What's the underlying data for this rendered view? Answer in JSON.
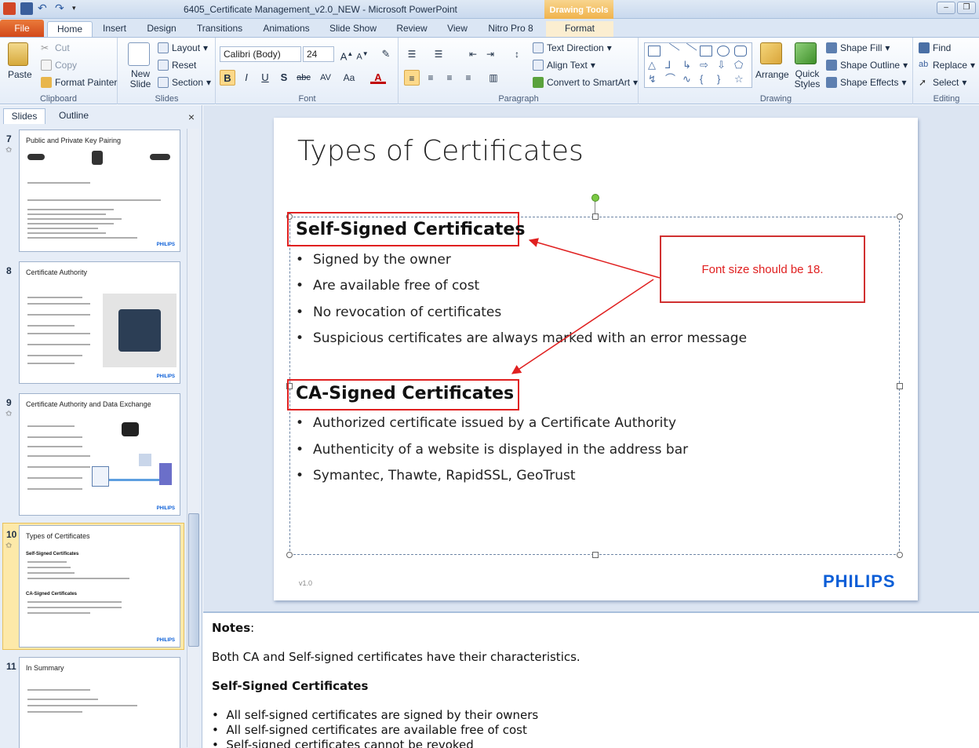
{
  "app": {
    "window_title": "6405_Certificate Management_v2.0_NEW  -  Microsoft PowerPoint",
    "context_tab_group": "Drawing Tools"
  },
  "tabs": [
    "File",
    "Home",
    "Insert",
    "Design",
    "Transitions",
    "Animations",
    "Slide Show",
    "Review",
    "View",
    "Nitro Pro 8",
    "Format"
  ],
  "ribbon": {
    "clipboard": {
      "paste": "Paste",
      "cut": "Cut",
      "copy": "Copy",
      "format_painter": "Format Painter",
      "label": "Clipboard"
    },
    "slides": {
      "new_slide": "New Slide",
      "layout": "Layout",
      "reset": "Reset",
      "section": "Section",
      "label": "Slides"
    },
    "font": {
      "family": "Calibri (Body)",
      "size": "24",
      "label": "Font"
    },
    "paragraph": {
      "text_direction": "Text Direction",
      "align_text": "Align Text",
      "convert": "Convert to SmartArt",
      "label": "Paragraph"
    },
    "drawing": {
      "arrange": "Arrange",
      "quick_styles": "Quick Styles",
      "shape_fill": "Shape Fill",
      "shape_outline": "Shape Outline",
      "shape_effects": "Shape Effects",
      "label": "Drawing"
    },
    "editing": {
      "find": "Find",
      "replace": "Replace",
      "select": "Select",
      "label": "Editing"
    }
  },
  "panel": {
    "tab_slides": "Slides",
    "tab_outline": "Outline",
    "close": "×"
  },
  "thumbnails": [
    {
      "num": "7",
      "title": "Public and Private Key Pairing"
    },
    {
      "num": "8",
      "title": "Certificate Authority"
    },
    {
      "num": "9",
      "title": "Certificate Authority and Data Exchange"
    },
    {
      "num": "10",
      "title": "Types of Certificates",
      "sub1": "Self-Signed Certificates",
      "sub2": "CA-Signed Certificates"
    },
    {
      "num": "11",
      "title": "In Summary"
    }
  ],
  "slide": {
    "title": "Types of Certificates",
    "section1": {
      "heading": "Self-Signed Certificates",
      "bullets": [
        "Signed by the owner",
        "Are available free of cost",
        "No revocation of certificates",
        "Suspicious certificates are always marked with an error message"
      ]
    },
    "section2": {
      "heading": "CA-Signed Certificates",
      "bullets": [
        "Authorized certificate issued by a Certificate Authority",
        "Authenticity of a website is displayed in the address bar",
        "Symantec, Thawte, RapidSSL, GeoTrust"
      ]
    },
    "callout": "Font size should be 18.",
    "version": "v1.0",
    "brand": "PHILIPS",
    "thumb_brand": "PHILIPS"
  },
  "notes": {
    "label": "Notes",
    "intro": "Both CA and Self-signed certificates have their characteristics.",
    "heading": "Self-Signed Certificates",
    "bullets": [
      "All self-signed certificates are signed by their owners",
      "All self-signed certificates are available free of cost",
      "Self-signed certificates cannot be revoked"
    ]
  },
  "colors": {
    "accent": "#0b5ed7",
    "callout_red": "#e02020",
    "file_tab": "#d2491b"
  }
}
